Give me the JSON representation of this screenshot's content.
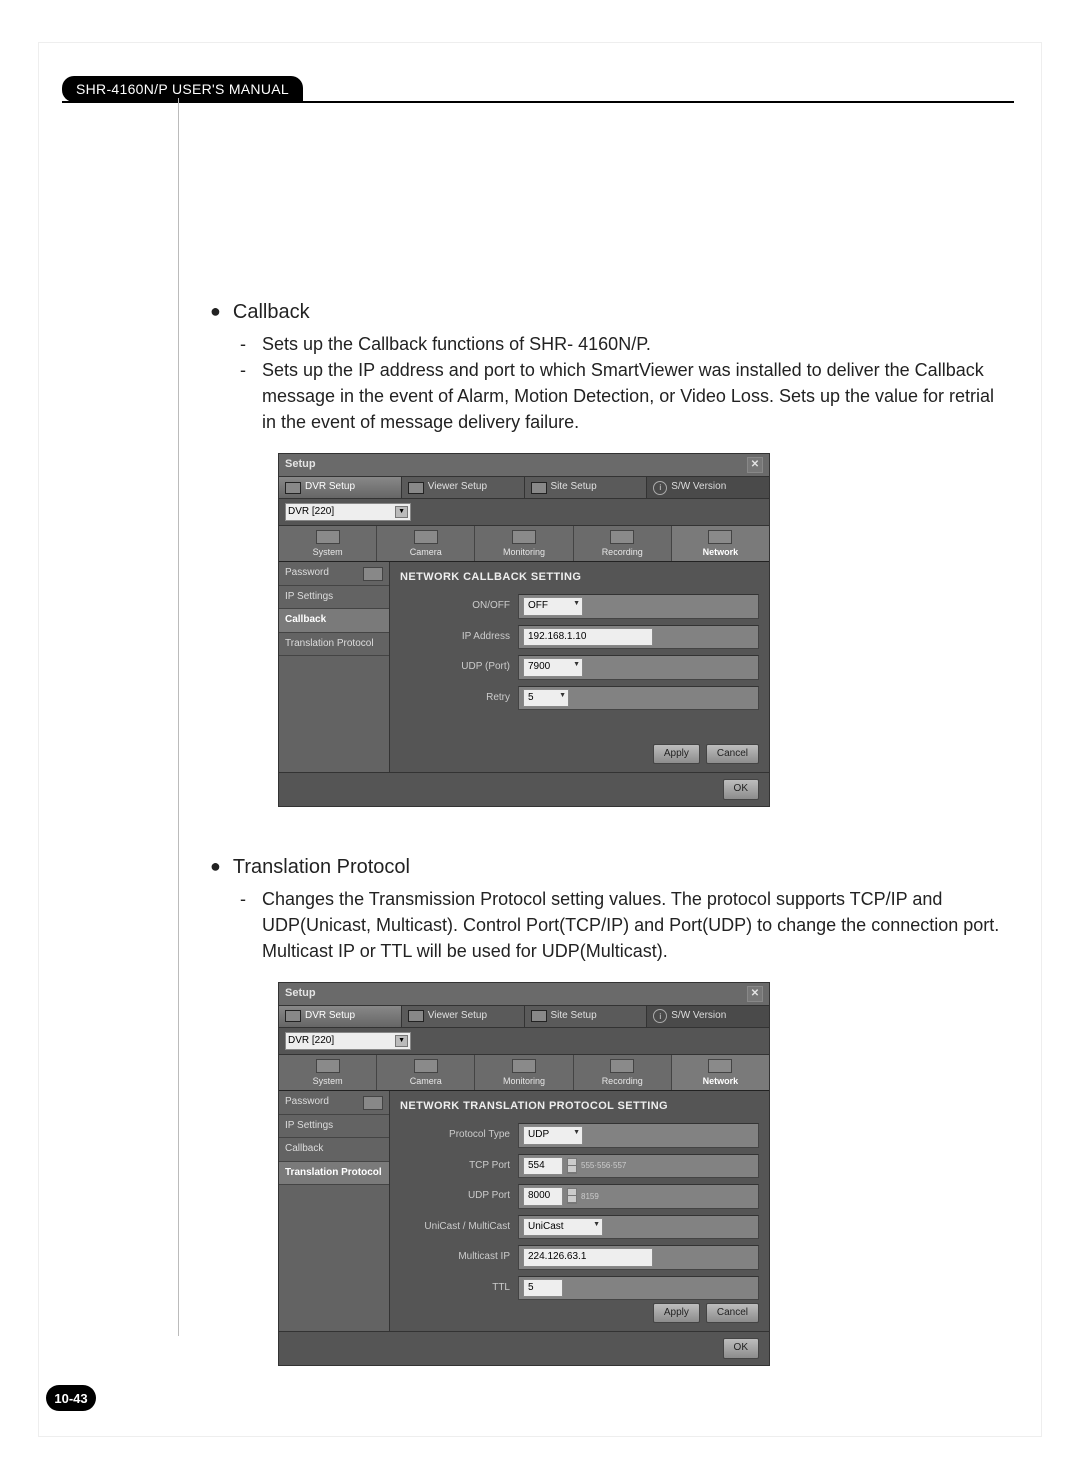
{
  "header": {
    "title": "SHR-4160N/P USER'S MANUAL"
  },
  "page_number": "10-43",
  "section1": {
    "title": "Callback",
    "bullets": [
      "Sets up the Callback functions of SHR- 4160N/P.",
      "Sets up the IP address and port to which SmartViewer was installed to deliver the Callback message in the event of Alarm, Motion Detection, or Video Loss. Sets up the value for retrial in the event of message delivery failure."
    ]
  },
  "section2": {
    "title": "Translation Protocol",
    "bullets": [
      "Changes the Transmission Protocol setting values. The protocol supports TCP/IP and UDP(Unicast, Multicast). Control Port(TCP/IP) and Port(UDP) to change the connection port. Multicast IP or TTL will be used for UDP(Multicast)."
    ]
  },
  "dialog": {
    "title": "Setup",
    "tabs": {
      "dvr": "DVR Setup",
      "viewer": "Viewer Setup",
      "site": "Site Setup",
      "version": "S/W Version"
    },
    "dvr_select": "DVR [220]",
    "modes": {
      "system": "System",
      "camera": "Camera",
      "monitoring": "Monitoring",
      "recording": "Recording",
      "network": "Network"
    },
    "sidebar": {
      "password": "Password",
      "ip": "IP Settings",
      "callback": "Callback",
      "translation": "Translation Protocol"
    },
    "buttons": {
      "apply": "Apply",
      "cancel": "Cancel",
      "ok": "OK"
    }
  },
  "callback_form": {
    "section_title": "NETWORK CALLBACK SETTING",
    "onoff_label": "ON/OFF",
    "onoff_value": "OFF",
    "ip_label": "IP Address",
    "ip_value": "192.168.1.10",
    "udp_label": "UDP (Port)",
    "udp_value": "7900",
    "retry_label": "Retry",
    "retry_value": "5"
  },
  "trans_form": {
    "section_title": "NETWORK TRANSLATION PROTOCOL SETTING",
    "proto_label": "Protocol Type",
    "proto_value": "UDP",
    "tcp_label": "TCP Port",
    "tcp_value1": "554",
    "tcp_value2": "555·556·557",
    "udp_label": "UDP Port",
    "udp_value1": "8000",
    "udp_value2": "8159",
    "cast_label": "UniCast / MultiCast",
    "cast_value": "UniCast",
    "mcast_label": "Multicast IP",
    "mcast_value": "224.126.63.1",
    "ttl_label": "TTL",
    "ttl_value": "5"
  }
}
